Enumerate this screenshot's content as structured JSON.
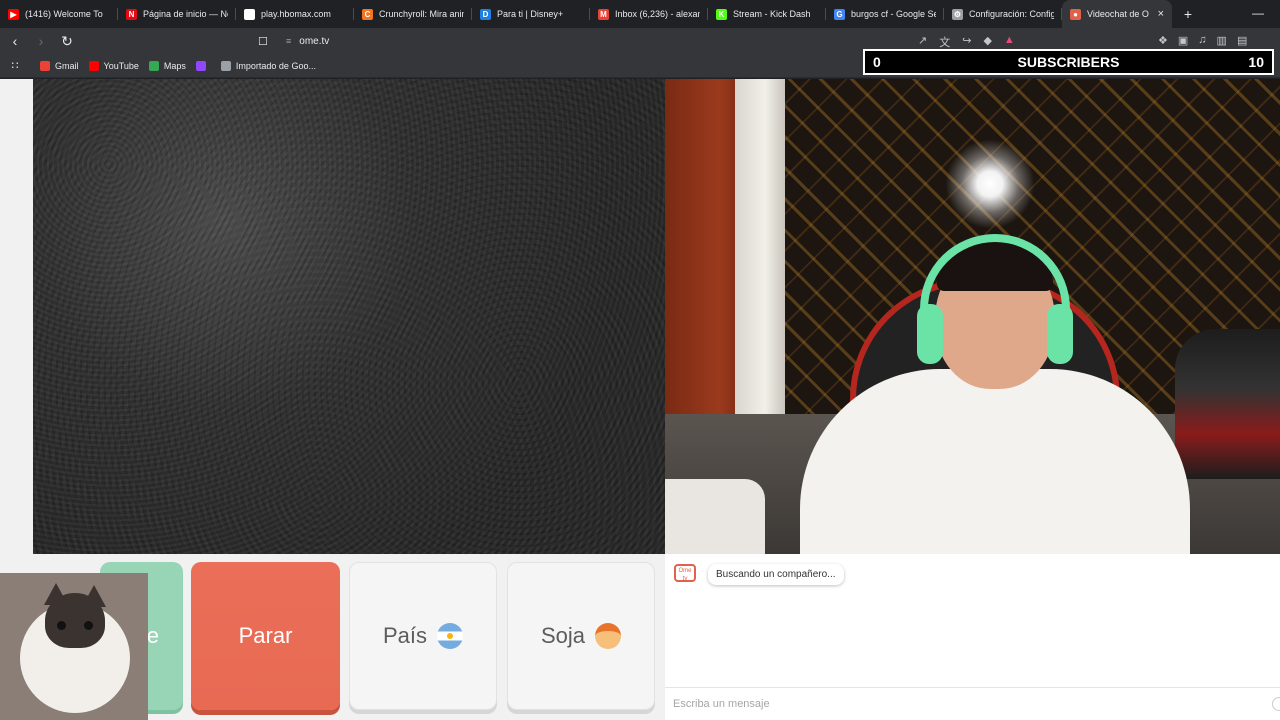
{
  "browser": {
    "tabs": [
      {
        "title": "(1416) Welcome To",
        "color": "#ff0000",
        "glyph": "▶"
      },
      {
        "title": "Página de inicio — Ne",
        "color": "#e50914",
        "glyph": "N"
      },
      {
        "title": "play.hbomax.com",
        "color": "#ffffff",
        "glyph": "●"
      },
      {
        "title": "Crunchyroll: Mira anim",
        "color": "#f47521",
        "glyph": "C"
      },
      {
        "title": "Para ti | Disney+",
        "color": "#1f80e0",
        "glyph": "D"
      },
      {
        "title": "Inbox (6,236) - alexand",
        "color": "#ea4335",
        "glyph": "M"
      },
      {
        "title": "Stream - Kick Dash",
        "color": "#53fc18",
        "glyph": "K"
      },
      {
        "title": "burgos cf - Google Se",
        "color": "#4285f4",
        "glyph": "G"
      },
      {
        "title": "Configuración: Config",
        "color": "#9aa0a6",
        "glyph": "⚙"
      },
      {
        "title": "Videochat de O",
        "color": "#e0624c",
        "glyph": "●"
      }
    ],
    "new_tab": "+",
    "minimize": "—",
    "url": "ome.tv",
    "bookmarks": [
      {
        "label": "Gmail",
        "color": "#ea4335"
      },
      {
        "label": "YouTube",
        "color": "#ff0000"
      },
      {
        "label": "Maps",
        "color": "#34a853"
      },
      {
        "label": "",
        "color": "#9146ff"
      },
      {
        "label": "Importado de Goo...",
        "color": "#9aa0a6"
      }
    ]
  },
  "overlay": {
    "left_count": "0",
    "label": "SUBSCRIBERS",
    "right_count": "10"
  },
  "controls": {
    "start_partial": "e",
    "stop": "Parar",
    "country": "País",
    "gender": "Soja"
  },
  "chat": {
    "logo": "Ome tv",
    "status": "Buscando un compañero...",
    "input_placeholder": "Escriba un mensaje"
  }
}
